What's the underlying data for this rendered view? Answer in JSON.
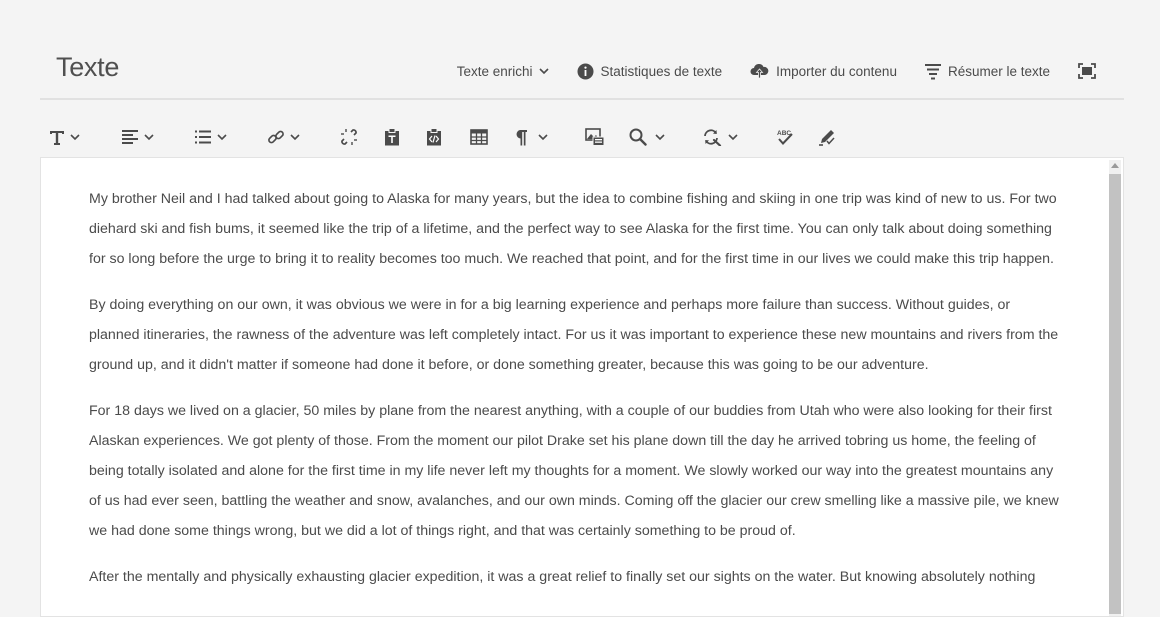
{
  "header": {
    "title": "Texte",
    "actions": {
      "rich_text_label": "Texte enrichi",
      "stats_label": "Statistiques de texte",
      "import_label": "Importer du contenu",
      "summarize_label": "Résumer le texte"
    }
  },
  "toolbar": {
    "tools": [
      {
        "icon": "text-format-icon",
        "dropdown": true
      },
      {
        "icon": "align-left-icon",
        "dropdown": true
      },
      {
        "icon": "list-icon",
        "dropdown": true
      },
      {
        "icon": "link-icon",
        "dropdown": true
      },
      {
        "icon": "unlink-icon",
        "dropdown": false
      },
      {
        "icon": "paste-text-icon",
        "dropdown": false
      },
      {
        "icon": "paste-code-icon",
        "dropdown": false
      },
      {
        "icon": "table-icon",
        "dropdown": false
      },
      {
        "icon": "paragraph-icon",
        "dropdown": true
      },
      {
        "icon": "image-icon",
        "dropdown": false
      },
      {
        "icon": "find-icon",
        "dropdown": true
      },
      {
        "icon": "find-replace-icon",
        "dropdown": true
      },
      {
        "icon": "spellcheck-icon",
        "dropdown": false
      },
      {
        "icon": "edit-check-icon",
        "dropdown": false
      }
    ]
  },
  "editor": {
    "paragraphs": [
      "My brother Neil and I had talked about going to Alaska for many years, but the idea to combine fishing and skiing in one trip was kind of new to us. For two diehard ski and fish bums, it seemed like the trip of a lifetime, and the perfect way to see Alaska for the first time. You can only talk about doing something for so long before the urge to bring it to reality becomes too much. We reached that point, and for the first time in our lives we could make this trip happen.",
      "By doing everything on our own, it was obvious we were in for a big learning experience and perhaps more failure than success. Without guides, or planned itineraries, the rawness of the adventure was left completely intact. For us it was important to experience these new mountains and rivers from the ground up, and it didn't matter if someone had done it before, or done something greater, because this was going to be our adventure.",
      "For 18 days we lived on a glacier, 50 miles by plane from the nearest anything, with a couple of our buddies from Utah who were also looking for their first Alaskan experiences. We got plenty of those. From the moment our pilot Drake set his plane down till the day he arrived tobring us home, the feeling of being totally isolated and alone for the first time in my life never left my thoughts for a moment. We slowly worked our way into the greatest mountains any of us had ever seen, battling the weather and snow, avalanches, and our own minds. Coming off the glacier our crew smelling like a massive pile, we knew we had done some things wrong, but we did a lot of things right, and that was certainly something to be proud of.",
      "After the mentally and physically exhausting glacier expedition, it was a great relief to finally set our sights on the water. But knowing absolutely nothing"
    ]
  }
}
